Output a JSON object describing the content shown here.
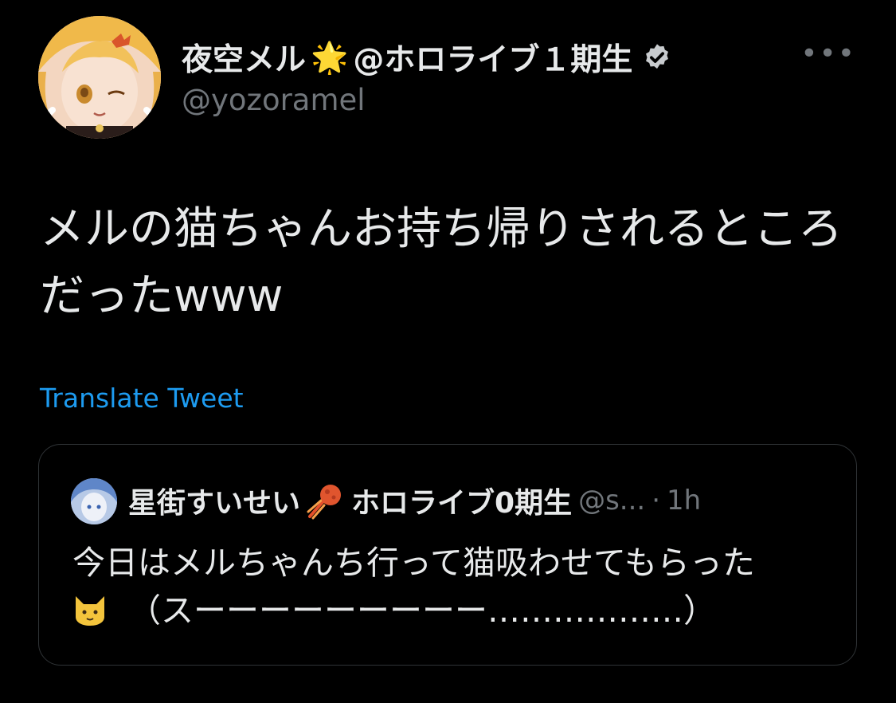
{
  "author": {
    "display_name": "夜空メル",
    "name_emoji": "🌟",
    "name_suffix": "@ホロライブ１期生",
    "handle": "@yozoramel"
  },
  "menu": {
    "more_label": "•••"
  },
  "tweet": {
    "text": "メルの猫ちゃんお持ち帰りされるところだったwww"
  },
  "translate_label": "Translate Tweet",
  "quoted": {
    "name": "星街すいせい",
    "name_suffix": "ホロライブ0期生",
    "handle": "@s...",
    "dot": "·",
    "time": "1h",
    "text_line1": "今日はメルちゃんち行って猫吸わせてもらった",
    "text_line2": "（スーーーーーーーーー………………）"
  },
  "colors": {
    "background": "#000000",
    "text_primary": "#e7e9ea",
    "text_secondary": "#71767b",
    "link": "#1d9bf0",
    "border": "#2f3336"
  }
}
